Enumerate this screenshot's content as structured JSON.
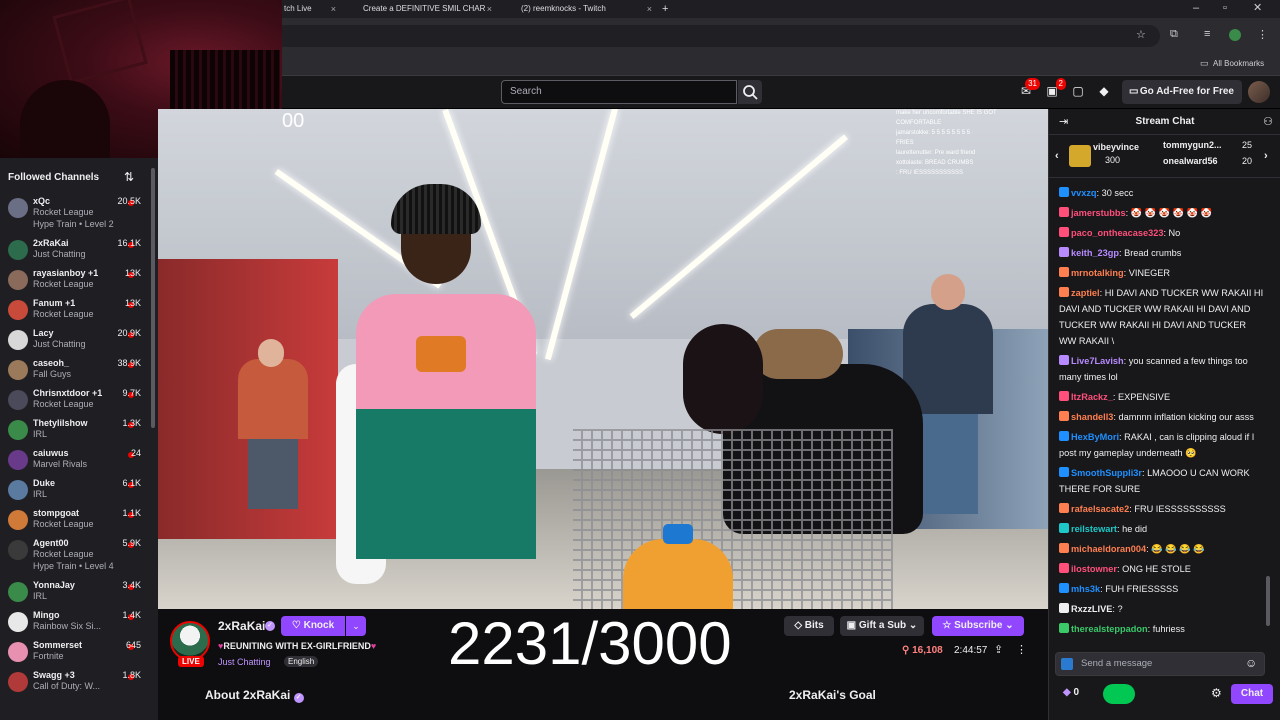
{
  "browser": {
    "tabs": [
      {
        "label": "tch Live"
      },
      {
        "label": "Create a DEFINITIVE SMIL CHAR"
      },
      {
        "label": "(2) reemknocks - Twitch"
      }
    ],
    "bookmarks_label": "All Bookmarks"
  },
  "topnav": {
    "search_placeholder": "Search",
    "inbox_badge": "31",
    "notifications_badge": "2",
    "adfree_label": "Go Ad-Free for Free"
  },
  "sidebar": {
    "header": "Followed Channels",
    "channels": [
      {
        "name": "xQc",
        "game": "Rocket League",
        "extra": "Hype Train • Level 2",
        "viewers": "20.5K",
        "avatar_color": "#6b6f85"
      },
      {
        "name": "2xRaKai",
        "game": "Just Chatting",
        "viewers": "16.1K",
        "avatar_color": "#2c6b4b"
      },
      {
        "name": "rayasianboy +1",
        "game": "Rocket League",
        "viewers": "13K",
        "avatar_color": "#8a6a5a"
      },
      {
        "name": "Fanum +1",
        "game": "Rocket League",
        "viewers": "13K",
        "avatar_color": "#c84a3a"
      },
      {
        "name": "Lacy",
        "game": "Just Chatting",
        "viewers": "20.9K",
        "avatar_color": "#d8d8d8"
      },
      {
        "name": "caseoh_",
        "game": "Fall Guys",
        "viewers": "38.9K",
        "avatar_color": "#9a7a5a"
      },
      {
        "name": "Chrisnxtdoor +1",
        "game": "Rocket League",
        "viewers": "9.7K",
        "avatar_color": "#4a4a5a"
      },
      {
        "name": "Thetylilshow",
        "game": "IRL",
        "viewers": "1.3K",
        "avatar_color": "#3a8a4a"
      },
      {
        "name": "caiuwus",
        "game": "Marvel Rivals",
        "viewers": "24",
        "avatar_color": "#6a3a8a"
      },
      {
        "name": "Duke",
        "game": "IRL",
        "viewers": "6.1K",
        "avatar_color": "#5a7aa0"
      },
      {
        "name": "stompgoat",
        "game": "Rocket League",
        "viewers": "1.1K",
        "avatar_color": "#d07a3a"
      },
      {
        "name": "Agent00",
        "game": "Rocket League",
        "extra": "Hype Train • Level 4",
        "viewers": "5.9K",
        "avatar_color": "#3a3a3a"
      },
      {
        "name": "YonnaJay",
        "game": "IRL",
        "viewers": "3.4K",
        "avatar_color": "#3a8a4a"
      },
      {
        "name": "Mingo",
        "game": "Rainbow Six Si...",
        "viewers": "1.4K",
        "avatar_color": "#e8e8e8"
      },
      {
        "name": "Sommerset",
        "game": "Fortnite",
        "viewers": "645",
        "avatar_color": "#e890b0"
      },
      {
        "name": "Swagg +3",
        "game": "Call of Duty: W...",
        "viewers": "1.8K",
        "avatar_color": "#b03a3a"
      }
    ]
  },
  "video": {
    "overlay_timer": "00",
    "overlay_chat": [
      "make her uncomfortable SHE IS GOT",
      "COMFORTABLE",
      "jamarstokke: 5 5 5 5 5 5 5 5",
      "                 FRIES",
      "laurettenutter: Pre ward friend",
      "xottolaste: BREAD CRUMBS",
      "                 : FRU IESSSSSSSSSSS"
    ]
  },
  "stream": {
    "streamer": "2xRaKai",
    "knock_label": "Knock",
    "title": "REUNITING WITH EX-GIRLFRIEND",
    "category": "Just Chatting",
    "language": "English",
    "live_label": "LIVE",
    "sub_counter": "2231/3000",
    "bits_label": "Bits",
    "gift_label": "Gift a Sub",
    "subscribe_label": "Subscribe",
    "viewers": "16,108",
    "uptime": "2:44:57",
    "about": "About 2xRaKai",
    "goal": "2xRaKai's Goal"
  },
  "chat": {
    "title": "Stream Chat",
    "leaderboard": [
      {
        "name": "vibeyvince",
        "count": "300"
      },
      {
        "name": "tommygun2...",
        "count": "25"
      },
      {
        "name": "onealward56",
        "count": "20"
      }
    ],
    "messages": [
      {
        "user": "vvxzq",
        "text": "30 secc",
        "color": "#1e90ff"
      },
      {
        "user": "jamerstubbs",
        "text": "🤡 🤡 🤡 🤡 🤡 🤡",
        "color": "#ff4f7a"
      },
      {
        "user": "paco_ontheacase323",
        "text": "No",
        "color": "#ff4f7a"
      },
      {
        "user": "keith_23gp",
        "text": "Bread crumbs",
        "color": "#b78bff"
      },
      {
        "user": "mrnotalking",
        "text": "VINEGER",
        "color": "#ff7f50"
      },
      {
        "user": "zaptiel",
        "text": "HI DAVI AND TUCKER WW RAKAII HI DAVI AND TUCKER WW RAKAII HI DAVI AND TUCKER WW RAKAII HI DAVI AND TUCKER WW RAKAII \\",
        "color": "#ff7f50"
      },
      {
        "user": "Live7Lavish",
        "text": "you scanned a few things too many times lol",
        "color": "#b78bff"
      },
      {
        "user": "ItzRackz_",
        "text": "EXPENSIVE",
        "color": "#ff4f7a"
      },
      {
        "user": "shandell3",
        "text": "damnnn inflation kicking our asss",
        "color": "#ff7f50"
      },
      {
        "user": "HexByMori",
        "text": "RAKAI , can is clipping aloud if I post my gameplay underneath 🥺",
        "color": "#1e90ff"
      },
      {
        "user": "SmoothSuppli3r",
        "text": "LMAOOO U CAN WORK THERE FOR SURE",
        "color": "#1e90ff"
      },
      {
        "user": "rafaelsacate2",
        "text": "FRU IESSSSSSSSSS",
        "color": "#ff7f50"
      },
      {
        "user": "reilstewart",
        "text": "he did",
        "color": "#1ec8c8"
      },
      {
        "user": "michaeldoran004",
        "text": "😂 😂 😂 😂",
        "color": "#ff7f50"
      },
      {
        "user": "ilostowner",
        "text": "ONG HE STOLE",
        "color": "#ff4f7a"
      },
      {
        "user": "mhs3k",
        "text": "FUH FRIESSSSS",
        "color": "#1e90ff"
      },
      {
        "user": "RxzzLIVE",
        "text": "?",
        "color": "#efeff1"
      },
      {
        "user": "therealsteppadon",
        "text": "fuhriess",
        "color": "#3ac868"
      }
    ],
    "input_placeholder": "Send a message",
    "bits_count": "0",
    "chat_button": "Chat"
  }
}
